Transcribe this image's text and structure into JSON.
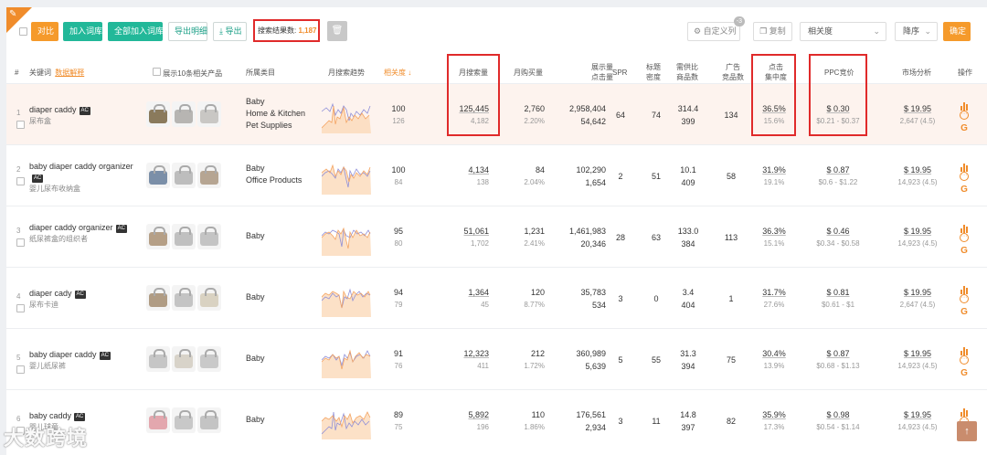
{
  "toolbar": {
    "compare": "对比",
    "add_to_lib": "加入词库",
    "add_all_to_lib": "全部加入词库",
    "export_detail": "导出明细",
    "export": "导出",
    "result_label": "搜索结果数:",
    "result_count": "1,187",
    "custom_columns": "自定义列",
    "custom_columns_badge": "-3",
    "copy": "复制",
    "sort_field": "相关度",
    "sort_order": "降序",
    "confirm": "确定"
  },
  "headers": {
    "index": "#",
    "keyword": "关键词",
    "keyword_explain": "数据解释",
    "show_products": "展示10条相关产品",
    "category": "所属类目",
    "trend": "月搜索趋势",
    "relevance": "相关度",
    "monthly_search": "月搜索量",
    "monthly_buy": "月购买量",
    "impressions_1": "展示量",
    "impressions_2": "点击量",
    "spr": "SPR",
    "title_density_1": "标题",
    "title_density_2": "密度",
    "supply_demand_1": "需供比",
    "supply_demand_2": "商品数",
    "ad_products_1": "广告",
    "ad_products_2": "竞品数",
    "click_conc_1": "点击",
    "click_conc_2": "集中度",
    "ppc": "PPC竞价",
    "market": "市场分析",
    "actions": "操作"
  },
  "rows": [
    {
      "index": "1",
      "keyword": "diaper caddy",
      "ac": "AC",
      "keyword_cn": "尿布盒",
      "categories": [
        "Baby",
        "Home & Kitchen",
        "Pet Supplies"
      ],
      "relevance": "100",
      "relevance_sub": "126",
      "search": "125,445",
      "search_sub": "4,182",
      "buy": "2,760",
      "buy_pct": "2.20%",
      "impressions": "2,958,404",
      "clicks": "54,642",
      "spr": "64",
      "density": "74",
      "supply": "314.4",
      "supply_sub": "399",
      "ads": "134",
      "conc": "36.5%",
      "conc_sub": "15.6%",
      "ppc": "$ 0.30",
      "ppc_range": "$0.21 - $0.37",
      "price": "$ 19.95",
      "rating": "2,647 (4.5)",
      "bag_colors": [
        "#8a7a5c",
        "#b7b5b2",
        "#c9c7c4"
      ]
    },
    {
      "index": "2",
      "keyword": "baby diaper caddy organizer",
      "ac": "AC",
      "keyword_cn": "婴儿尿布收纳盒",
      "categories": [
        "Baby",
        "Office Products"
      ],
      "relevance": "100",
      "relevance_sub": "84",
      "search": "4,134",
      "search_sub": "138",
      "buy": "84",
      "buy_pct": "2.04%",
      "impressions": "102,290",
      "clicks": "1,654",
      "spr": "2",
      "density": "51",
      "supply": "10.1",
      "supply_sub": "409",
      "ads": "58",
      "conc": "31.9%",
      "conc_sub": "19.1%",
      "ppc": "$ 0.87",
      "ppc_range": "$0.6 - $1.22",
      "price": "$ 19.95",
      "rating": "14,923 (4.5)",
      "bag_colors": [
        "#7b8fa8",
        "#bdbdbd",
        "#b6a592"
      ]
    },
    {
      "index": "3",
      "keyword": "diaper caddy organizer",
      "ac": "AC",
      "keyword_cn": "纸尿裤盒的组织者",
      "categories": [
        "Baby"
      ],
      "relevance": "95",
      "relevance_sub": "80",
      "search": "51,061",
      "search_sub": "1,702",
      "buy": "1,231",
      "buy_pct": "2.41%",
      "impressions": "1,461,983",
      "clicks": "20,346",
      "spr": "28",
      "density": "63",
      "supply": "133.0",
      "supply_sub": "384",
      "ads": "113",
      "conc": "36.3%",
      "conc_sub": "15.1%",
      "ppc": "$ 0.46",
      "ppc_range": "$0.34 - $0.58",
      "price": "$ 19.95",
      "rating": "14,923 (4.5)",
      "bag_colors": [
        "#b59f86",
        "#c0c0c0",
        "#c4c4c4"
      ]
    },
    {
      "index": "4",
      "keyword": "diaper cady",
      "ac": "AC",
      "keyword_cn": "尿布卡迪",
      "categories": [
        "Baby"
      ],
      "relevance": "94",
      "relevance_sub": "79",
      "search": "1,364",
      "search_sub": "45",
      "buy": "120",
      "buy_pct": "8.77%",
      "impressions": "35,783",
      "clicks": "534",
      "spr": "3",
      "density": "0",
      "supply": "3.4",
      "supply_sub": "404",
      "ads": "1",
      "conc": "31.7%",
      "conc_sub": "27.6%",
      "ppc": "$ 0.81",
      "ppc_range": "$0.61 - $1",
      "price": "$ 19.95",
      "rating": "2,647 (4.5)",
      "bag_colors": [
        "#b09c84",
        "#c4c4c4",
        "#d9d2c2"
      ]
    },
    {
      "index": "5",
      "keyword": "baby diaper caddy",
      "ac": "AC",
      "keyword_cn": "婴儿纸尿裤",
      "categories": [
        "Baby"
      ],
      "relevance": "91",
      "relevance_sub": "76",
      "search": "12,323",
      "search_sub": "411",
      "buy": "212",
      "buy_pct": "1.72%",
      "impressions": "360,989",
      "clicks": "5,639",
      "spr": "5",
      "density": "55",
      "supply": "31.3",
      "supply_sub": "394",
      "ads": "75",
      "conc": "30.4%",
      "conc_sub": "13.9%",
      "ppc": "$ 0.87",
      "ppc_range": "$0.68 - $1.13",
      "price": "$ 19.95",
      "rating": "14,923 (4.5)",
      "bag_colors": [
        "#c6c6c6",
        "#d8d3c9",
        "#c9c9c9"
      ]
    },
    {
      "index": "6",
      "keyword": "baby caddy",
      "ac": "AC",
      "keyword_cn": "婴儿球童",
      "categories": [
        "Baby"
      ],
      "relevance": "89",
      "relevance_sub": "75",
      "search": "5,892",
      "search_sub": "196",
      "buy": "110",
      "buy_pct": "1.86%",
      "impressions": "176,561",
      "clicks": "2,934",
      "spr": "3",
      "density": "11",
      "supply": "14.8",
      "supply_sub": "397",
      "ads": "82",
      "conc": "35.9%",
      "conc_sub": "17.3%",
      "ppc": "$ 0.98",
      "ppc_range": "$0.54 - $1.14",
      "price": "$ 19.95",
      "rating": "14,923 (4.5)",
      "bag_colors": [
        "#e3a7ae",
        "#c8c8c8",
        "#c4c4c4"
      ]
    }
  ],
  "watermark": "大数跨境",
  "colors": {
    "accent": "#f59a2b",
    "green": "#22b899",
    "highlight": "#e02a2a"
  }
}
